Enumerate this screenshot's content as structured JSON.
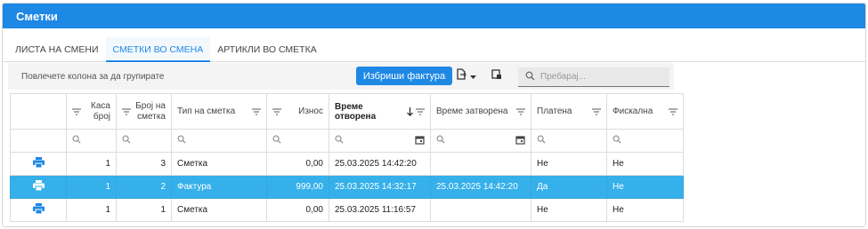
{
  "window": {
    "title": "Сметки"
  },
  "tabs": [
    {
      "label": "ЛИСТА НА СМЕНИ",
      "active": false
    },
    {
      "label": "СМЕТКИ ВО СМЕНА",
      "active": true
    },
    {
      "label": "АРТИКЛИ ВО СМЕТКА",
      "active": false
    }
  ],
  "toolbar": {
    "group_panel_text": "Повлечете колона за да групирате",
    "delete_invoice_label": "Избриши фактура",
    "search_placeholder": "Пребарај...",
    "export_icon": "export-icon",
    "column_chooser_icon": "column-chooser-icon"
  },
  "grid": {
    "columns": [
      {
        "label": ""
      },
      {
        "label": "Каса број"
      },
      {
        "label": "Број на сметка"
      },
      {
        "label": "Тип на сметка"
      },
      {
        "label": "Износ"
      },
      {
        "label": "Време отворена",
        "sort": "descending"
      },
      {
        "label": "Време затворена"
      },
      {
        "label": "Платена"
      },
      {
        "label": "Фискална"
      }
    ],
    "rows": [
      {
        "kasa": "1",
        "broj": "3",
        "tip": "Сметка",
        "iznos": "0,00",
        "otvorena": "25.03.2025 14:42:20",
        "zatvorena": "",
        "platena": "Не",
        "fiskalna": "Не",
        "selected": false
      },
      {
        "kasa": "1",
        "broj": "2",
        "tip": "Фактура",
        "iznos": "999,00",
        "otvorena": "25.03.2025 14:32:17",
        "zatvorena": "25.03.2025 14:42:20",
        "platena": "Да",
        "fiskalna": "Не",
        "selected": true
      },
      {
        "kasa": "1",
        "broj": "1",
        "tip": "Сметка",
        "iznos": "0,00",
        "otvorena": "25.03.2025 11:16:57",
        "zatvorena": "",
        "platena": "Не",
        "fiskalna": "Не",
        "selected": false
      }
    ]
  },
  "colors": {
    "accent": "#1e88e5",
    "selected_row": "#35b0ea",
    "print_icon": "#1e88e5"
  }
}
